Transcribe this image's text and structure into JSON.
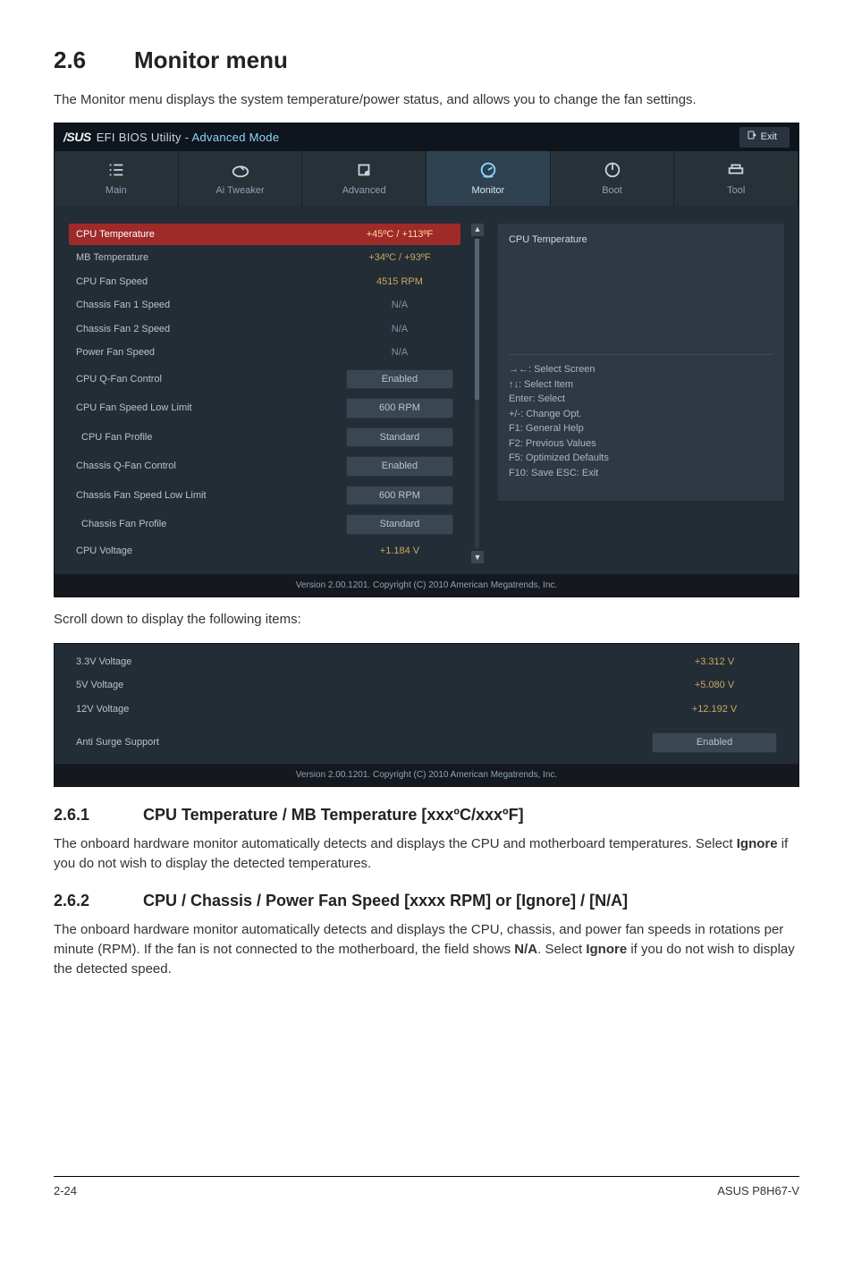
{
  "section": {
    "num": "2.6",
    "title": "Monitor menu"
  },
  "intro": "The Monitor menu displays the system temperature/power status, and allows you to change the fan settings.",
  "bios": {
    "brand_logo": "/SUS",
    "brand_text_a": "EFI BIOS Utility - ",
    "brand_text_b": "Advanced Mode",
    "exit_label": "Exit",
    "tabs": {
      "main": "Main",
      "ai": "Ai Tweaker",
      "adv": "Advanced",
      "mon": "Monitor",
      "boot": "Boot",
      "tool": "Tool"
    },
    "rows": {
      "cpu_temp": {
        "label": "CPU Temperature",
        "val": "+45ºC / +113ºF"
      },
      "mb_temp": {
        "label": "MB Temperature",
        "val": "+34ºC / +93ºF"
      },
      "cpu_fan": {
        "label": "CPU Fan Speed",
        "val": "4515 RPM"
      },
      "ch1": {
        "label": "Chassis Fan 1 Speed",
        "val": "N/A"
      },
      "ch2": {
        "label": "Chassis Fan 2 Speed",
        "val": "N/A"
      },
      "pwr": {
        "label": "Power Fan Speed",
        "val": "N/A"
      },
      "qfan": {
        "label": "CPU Q-Fan Control",
        "val": "Enabled"
      },
      "low": {
        "label": "CPU Fan Speed Low Limit",
        "val": "600 RPM"
      },
      "prof": {
        "label": "CPU Fan Profile",
        "val": "Standard"
      },
      "cqfan": {
        "label": "Chassis Q-Fan Control",
        "val": "Enabled"
      },
      "clow": {
        "label": "Chassis Fan Speed Low Limit",
        "val": "600 RPM"
      },
      "cprof": {
        "label": "Chassis Fan Profile",
        "val": "Standard"
      },
      "cpuv": {
        "label": "CPU Voltage",
        "val": "+1.184 V"
      }
    },
    "sidebar": {
      "heading": "CPU Temperature",
      "help": [
        "→←:  Select Screen",
        "↑↓:  Select Item",
        "Enter:  Select",
        "+/-:  Change Opt.",
        "F1:  General Help",
        "F2:  Previous Values",
        "F5:  Optimized Defaults",
        "F10:  Save   ESC:  Exit"
      ]
    },
    "footer": "Version  2.00.1201.   Copyright  (C)  2010  American  Megatrends,  Inc."
  },
  "scroll_caption": "Scroll down to display the following items:",
  "bios2": {
    "rows": {
      "v33": {
        "label": "3.3V Voltage",
        "val": "+3.312 V"
      },
      "v5": {
        "label": "5V Voltage",
        "val": "+5.080 V"
      },
      "v12": {
        "label": "12V Voltage",
        "val": "+12.192 V"
      },
      "surge": {
        "label": "Anti Surge Support",
        "val": "Enabled"
      }
    },
    "footer": "Version  2.00.1201.   Copyright  (C)  2010  American  Megatrends,  Inc."
  },
  "sub1": {
    "num": "2.6.1",
    "title": "CPU Temperature / MB Temperature [xxxºC/xxxºF]",
    "body_a": "The onboard hardware monitor automatically detects and displays the CPU and motherboard temperatures. Select ",
    "body_bold": "Ignore",
    "body_b": " if you do not wish to display the detected temperatures."
  },
  "sub2": {
    "num": "2.6.2",
    "title": "CPU / Chassis / Power Fan Speed [xxxx RPM] or [Ignore] / [N/A]",
    "body_a": "The onboard hardware monitor automatically detects and displays the CPU, chassis, and power fan speeds in rotations per minute (RPM). If the fan is not connected to the motherboard, the field shows ",
    "body_bold1": "N/A",
    "body_mid": ". Select ",
    "body_bold2": "Ignore",
    "body_b": " if you do not wish to display the detected speed."
  },
  "footer": {
    "left": "2-24",
    "right": "ASUS P8H67-V"
  }
}
